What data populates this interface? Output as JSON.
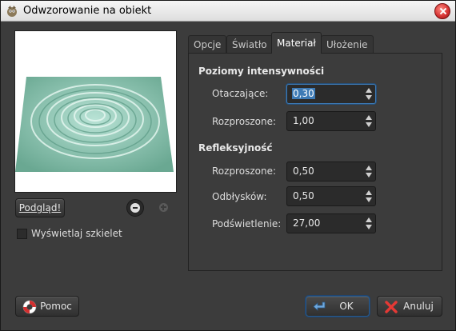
{
  "window": {
    "title": "Odwzorowanie na obiekt"
  },
  "left": {
    "preview_button": "Podgląd!",
    "wireframe_checkbox": {
      "label": "Wyświetlaj szkielet",
      "checked": false
    }
  },
  "tabs": [
    {
      "label": "Opcje",
      "active": false
    },
    {
      "label": "Światło",
      "active": false
    },
    {
      "label": "Materiał",
      "active": true
    },
    {
      "label": "Ułożenie",
      "active": false
    }
  ],
  "material": {
    "intensity_title": "Poziomy intensywności",
    "ambient_label": "Otaczające:",
    "ambient_value": "0,30",
    "diffuse_label": "Rozproszone:",
    "diffuse_value": "1,00",
    "reflectivity_title": "Refleksyjność",
    "refl_diffuse_label": "Rozproszone:",
    "refl_diffuse_value": "0,50",
    "specular_label": "Odbłysków:",
    "specular_value": "0,50",
    "highlight_label": "Podświetlenie:",
    "highlight_value": "27,00"
  },
  "footer": {
    "help_label": "Pomoc",
    "ok_label": "OK",
    "cancel_label": "Anuluj"
  },
  "colors": {
    "accent": "#3d7ab5",
    "background": "#3c3c3c"
  }
}
